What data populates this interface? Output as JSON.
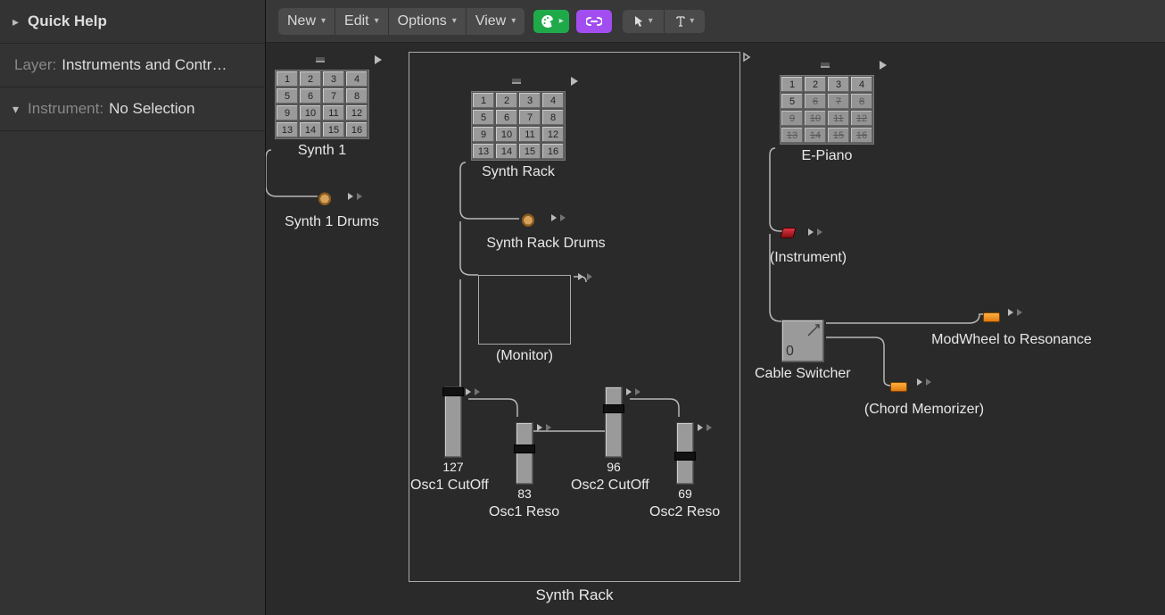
{
  "sidebar": {
    "quick_help": "Quick Help",
    "layer_label": "Layer:",
    "layer_value": "Instruments and Contr…",
    "instrument_label": "Instrument:",
    "instrument_value": "No Selection"
  },
  "menubar": {
    "new": "New",
    "edit": "Edit",
    "options": "Options",
    "view": "View"
  },
  "nodes": {
    "synth1": {
      "label": "Synth 1",
      "cells": [
        "1",
        "2",
        "3",
        "4",
        "5",
        "6",
        "7",
        "8",
        "9",
        "10",
        "11",
        "12",
        "13",
        "14",
        "15",
        "16"
      ]
    },
    "synth1_drums": {
      "label": "Synth 1 Drums"
    },
    "synth_rack": {
      "label": "Synth Rack",
      "cells": [
        "1",
        "2",
        "3",
        "4",
        "5",
        "6",
        "7",
        "8",
        "9",
        "10",
        "11",
        "12",
        "13",
        "14",
        "15",
        "16"
      ]
    },
    "synth_rack_drums": {
      "label": "Synth Rack Drums"
    },
    "monitor": {
      "label": "(Monitor)"
    },
    "epiano": {
      "label": "E-Piano",
      "cells": [
        "1",
        "2",
        "3",
        "4",
        "5",
        "6",
        "7",
        "8",
        "9",
        "10",
        "11",
        "12",
        "13",
        "14",
        "15",
        "16"
      ]
    },
    "instrument_obj": {
      "label": "(Instrument)"
    },
    "cable_switcher": {
      "label": "Cable Switcher",
      "value": "0"
    },
    "modwheel": {
      "label": "ModWheel to Resonance"
    },
    "chord_mem": {
      "label": "(Chord Memorizer)"
    },
    "group": {
      "label": "Synth Rack"
    },
    "faders": {
      "osc1_cutoff": {
        "label": "Osc1 CutOff",
        "value": "127",
        "track_h": 80,
        "pos": 0
      },
      "osc1_reso": {
        "label": "Osc1 Reso",
        "value": "83",
        "track_h": 70,
        "pos": 0.35
      },
      "osc2_cutoff": {
        "label": "Osc2 CutOff",
        "value": "96",
        "track_h": 80,
        "pos": 0.24
      },
      "osc2_reso": {
        "label": "Osc2 Reso",
        "value": "69",
        "track_h": 70,
        "pos": 0.46
      }
    }
  }
}
